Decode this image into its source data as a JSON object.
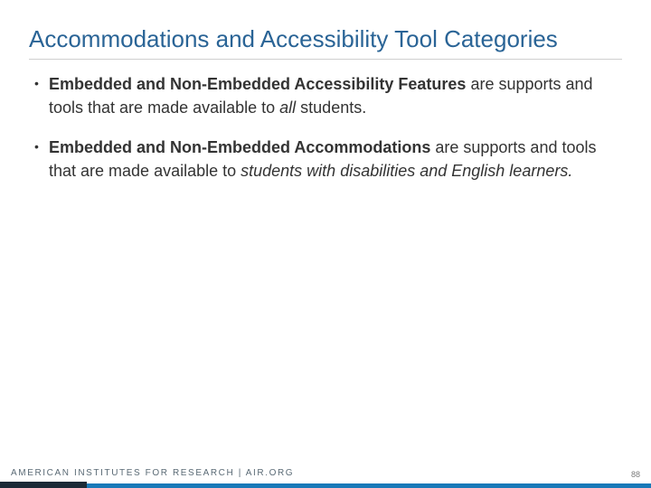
{
  "title": "Accommodations and Accessibility Tool Categories",
  "bullet1": {
    "bold": "Embedded and Non-Embedded Accessibility Features",
    "mid1": " are supports and tools that are made available to ",
    "italic": "all",
    "tail": " students."
  },
  "bullet2": {
    "bold": "Embedded and Non-Embedded Accommodations",
    "mid1": " are supports and tools that are made available to ",
    "italic": "students with disabilities and English learners.",
    "tail": ""
  },
  "footer": {
    "org": "AMERICAN INSTITUTES FOR RESEARCH | AIR.ORG",
    "page": "88"
  }
}
